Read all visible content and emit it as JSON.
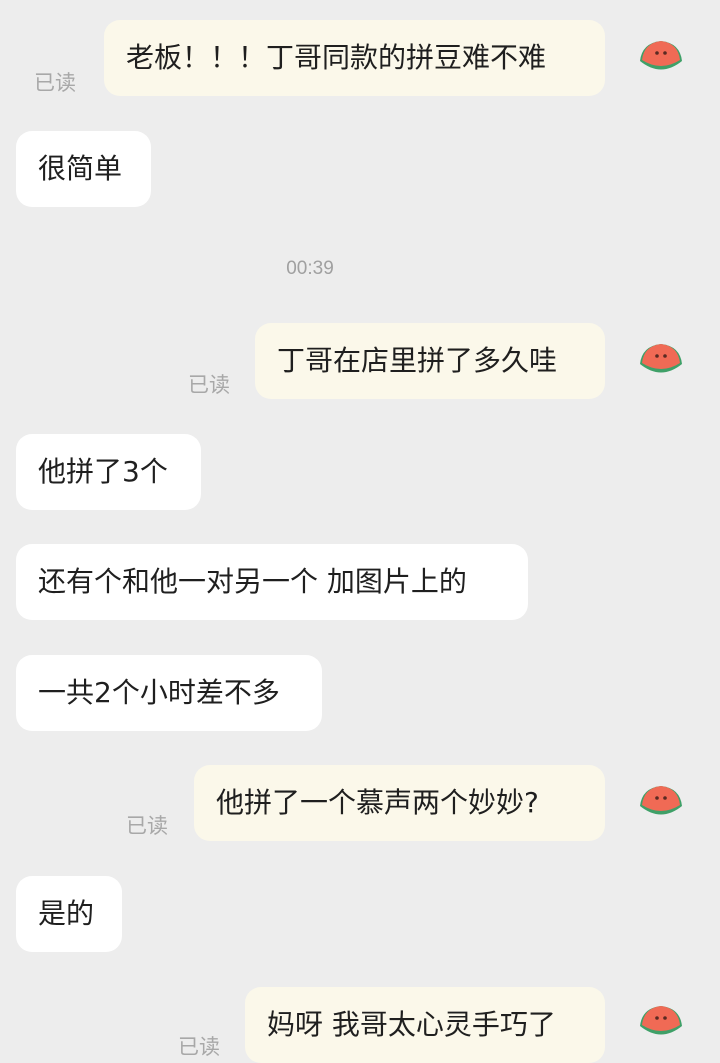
{
  "messages": [
    {
      "side": "mine",
      "text": "老板！！！丁哥同款的拼豆难不难",
      "status": "已读"
    },
    {
      "side": "theirs",
      "text": "很简单"
    },
    {
      "side": "system",
      "text": "00:39"
    },
    {
      "side": "mine",
      "text": "丁哥在店里拼了多久哇",
      "status": "已读"
    },
    {
      "side": "theirs",
      "text": "他拼了3个"
    },
    {
      "side": "theirs",
      "text": "还有个和他一对另一个 加图片上的"
    },
    {
      "side": "theirs",
      "text": "一共2个小时差不多"
    },
    {
      "side": "mine",
      "text": "他拼了一个慕声两个妙妙?",
      "status": "已读"
    },
    {
      "side": "theirs",
      "text": "是的"
    },
    {
      "side": "mine",
      "text": "妈呀 我哥太心灵手巧了",
      "status": "已读"
    }
  ],
  "avatar": {
    "icon": "watermelon-icon",
    "flesh_color": "#f06a55",
    "rind_color": "#3fa068"
  },
  "colors": {
    "background": "#ededed",
    "mine_bubble": "#fbf8ea",
    "theirs_bubble": "#ffffff",
    "read_text": "#a8a8a8"
  }
}
